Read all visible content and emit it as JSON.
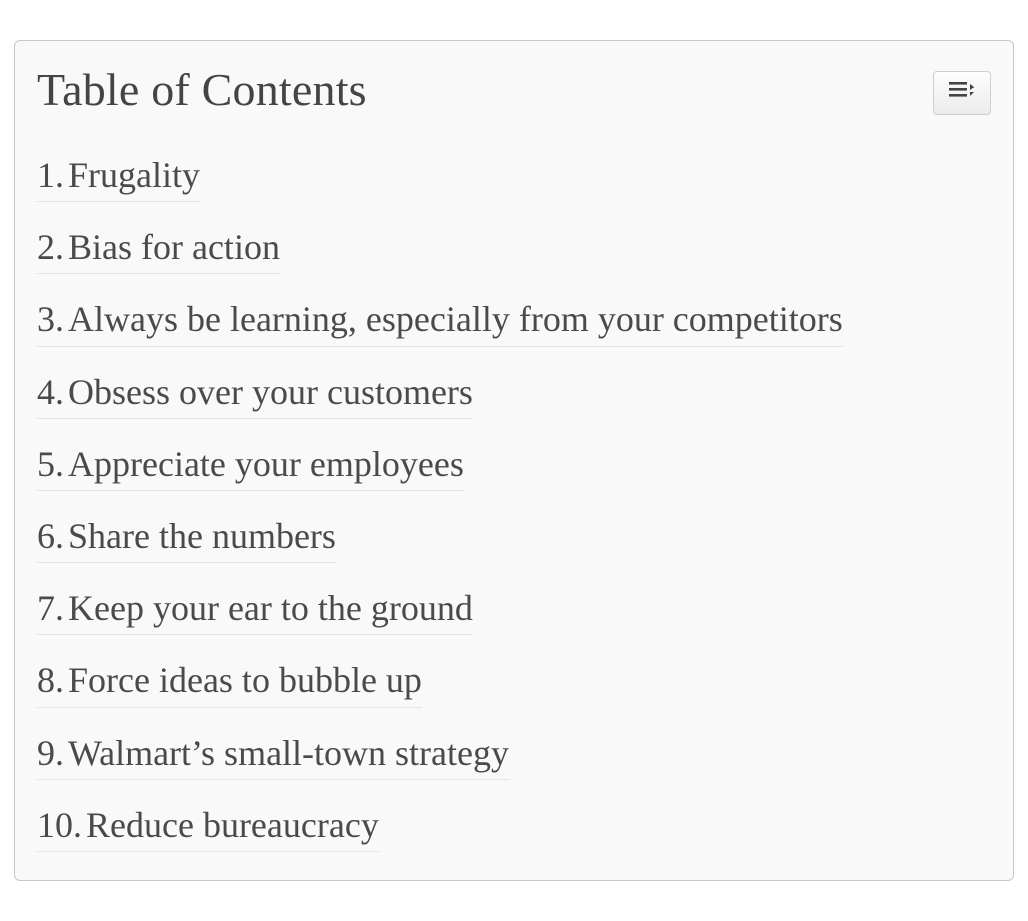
{
  "toc": {
    "title": "Table of Contents",
    "items": [
      {
        "num": "1.",
        "label": "Frugality"
      },
      {
        "num": "2.",
        "label": "Bias for action"
      },
      {
        "num": "3.",
        "label": "Always be learning, especially from your competitors"
      },
      {
        "num": "4.",
        "label": "Obsess over your customers"
      },
      {
        "num": "5.",
        "label": "Appreciate your employees"
      },
      {
        "num": "6.",
        "label": "Share the numbers"
      },
      {
        "num": "7.",
        "label": "Keep your ear to the ground"
      },
      {
        "num": "8.",
        "label": "Force ideas to bubble up"
      },
      {
        "num": "9.",
        "label": "Walmart’s small-town strategy"
      },
      {
        "num": "10.",
        "label": "Reduce bureaucracy"
      }
    ]
  }
}
